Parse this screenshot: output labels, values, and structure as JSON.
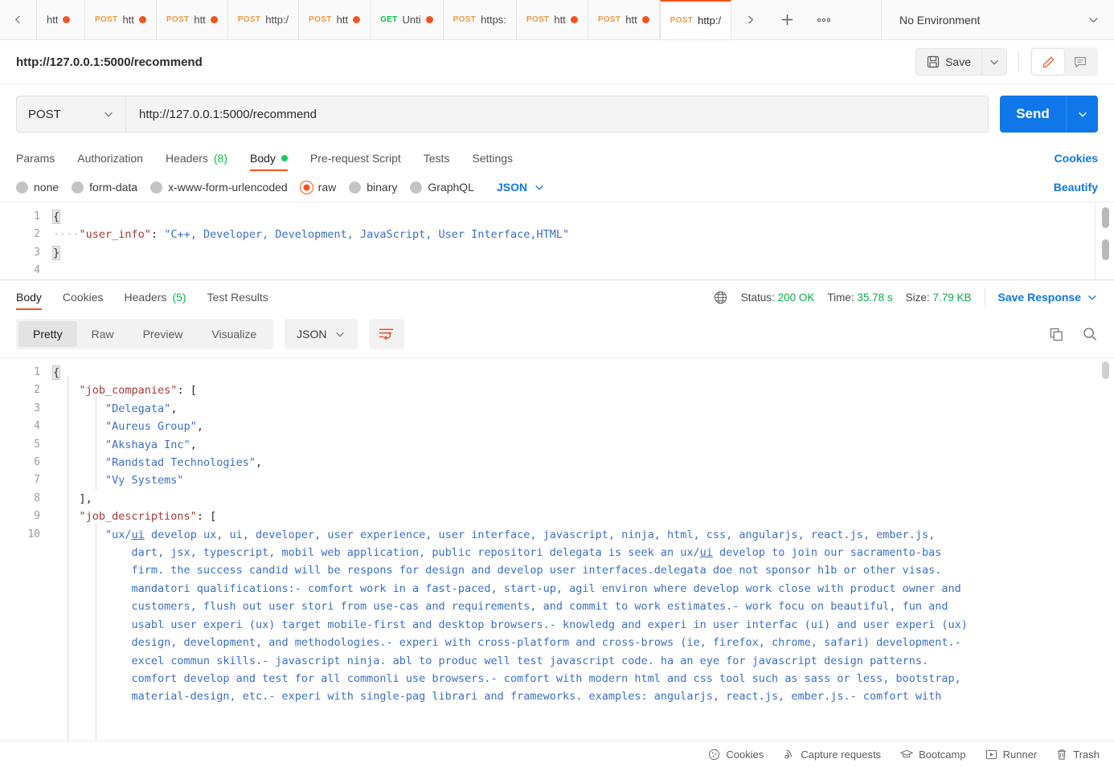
{
  "tabstrip": {
    "scroll_left_icon": "chevron-left-icon",
    "tabs": [
      {
        "method": "",
        "label": "htt",
        "unsaved": true,
        "active": false
      },
      {
        "method": "POST",
        "label": "htt",
        "unsaved": true,
        "active": false
      },
      {
        "method": "POST",
        "label": "htt",
        "unsaved": true,
        "active": false
      },
      {
        "method": "POST",
        "label": "http:/",
        "unsaved": false,
        "active": false
      },
      {
        "method": "POST",
        "label": "htt",
        "unsaved": true,
        "active": false
      },
      {
        "method": "GET",
        "label": "Unti",
        "unsaved": true,
        "active": false
      },
      {
        "method": "POST",
        "label": "https:",
        "unsaved": false,
        "active": false
      },
      {
        "method": "POST",
        "label": "htt",
        "unsaved": true,
        "active": false
      },
      {
        "method": "POST",
        "label": "htt",
        "unsaved": true,
        "active": false
      },
      {
        "method": "POST",
        "label": "http:/",
        "unsaved": false,
        "active": true
      }
    ],
    "next_icon": "chevron-right-icon",
    "new_tab_icon": "plus-icon",
    "more_icon": "ellipsis-icon",
    "environment": "No Environment",
    "environment_caret": "chevron-down-icon"
  },
  "request_header": {
    "title": "http://127.0.0.1:5000/recommend",
    "save_label": "Save",
    "save_icon": "floppy-disk-icon",
    "save_caret_icon": "chevron-down-icon",
    "edit_icon": "pencil-icon",
    "comment_icon": "comment-icon"
  },
  "url_bar": {
    "method": "POST",
    "method_caret_icon": "chevron-down-icon",
    "url": "http://127.0.0.1:5000/recommend",
    "send_label": "Send",
    "send_caret_icon": "chevron-down-icon"
  },
  "request_tabs": {
    "items": [
      {
        "label": "Params",
        "active": false
      },
      {
        "label": "Authorization",
        "active": false
      },
      {
        "label": "Headers",
        "count": "(8)",
        "active": false
      },
      {
        "label": "Body",
        "active": true,
        "dot": true
      },
      {
        "label": "Pre-request Script",
        "active": false
      },
      {
        "label": "Tests",
        "active": false
      },
      {
        "label": "Settings",
        "active": false
      }
    ],
    "cookies_label": "Cookies"
  },
  "body_types": {
    "options": [
      {
        "label": "none",
        "selected": false
      },
      {
        "label": "form-data",
        "selected": false
      },
      {
        "label": "x-www-form-urlencoded",
        "selected": false
      },
      {
        "label": "raw",
        "selected": true
      },
      {
        "label": "binary",
        "selected": false
      },
      {
        "label": "GraphQL",
        "selected": false
      }
    ],
    "format": "JSON",
    "format_caret_icon": "chevron-down-icon",
    "beautify_label": "Beautify"
  },
  "request_body": {
    "line_numbers": [
      "1",
      "2",
      "3",
      "4"
    ],
    "lines": [
      "{",
      "    \"user_info\": \"C++, Developer, Development, JavaScript, User Interface,HTML\"",
      "}",
      ""
    ],
    "key": "\"user_info\"",
    "value": "\"C++, Developer, Development, JavaScript, User Interface,HTML\""
  },
  "response": {
    "tabs": [
      {
        "label": "Body",
        "active": true
      },
      {
        "label": "Cookies",
        "active": false
      },
      {
        "label": "Headers",
        "count": "(5)",
        "active": false
      },
      {
        "label": "Test Results",
        "active": false
      }
    ],
    "globe_icon": "globe-icon",
    "status_label": "Status:",
    "status_value": "200 OK",
    "time_label": "Time:",
    "time_value": "35.78 s",
    "size_label": "Size:",
    "size_value": "7.79 KB",
    "save_response_label": "Save Response",
    "save_response_caret_icon": "chevron-down-icon",
    "view_modes": [
      {
        "label": "Pretty",
        "active": true
      },
      {
        "label": "Raw",
        "active": false
      },
      {
        "label": "Preview",
        "active": false
      },
      {
        "label": "Visualize",
        "active": false
      }
    ],
    "format": "JSON",
    "format_caret_icon": "chevron-down-icon",
    "wrap_icon": "wrap-lines-icon",
    "copy_icon": "copy-icon",
    "search_icon": "search-icon"
  },
  "response_body": {
    "line_numbers": [
      "1",
      "2",
      "3",
      "4",
      "5",
      "6",
      "7",
      "8",
      "9",
      "10"
    ],
    "job_companies_key": "\"job_companies\"",
    "job_companies": [
      "\"Delegata\",",
      "\"Aureus Group\",",
      "\"Akshaya Inc\",",
      "\"Randstad Technologies\",",
      "\"Vy Systems\""
    ],
    "job_descriptions_key": "\"job_descriptions\"",
    "description_lines": [
      "\"ux/ui develop ux, ui, developer, user experience, user interface, javascript, ninja, html, css, angularjs, react.js, ember.js,",
      "dart, jsx, typescript, mobil web application, public repositori delegata is seek an ux/ui develop to join our sacramento-bas",
      "firm. the success candid will be respons for design and develop user interfaces.delegata doe not sponsor h1b or other visas.",
      "mandatori qualifications:- comfort work in a fast-paced, start-up, agil environ where develop work close with product owner and",
      "customers, flush out user stori from use-cas and requirements, and commit to work estimates.- work focu on beautiful, fun and",
      "usabl user experi (ux) target mobile-first and desktop browsers.- knowledg and experi in user interfac (ui) and user experi (ux)",
      "design, development, and methodologies.- experi with cross-platform and cross-brows (ie, firefox, chrome, safari) development.-",
      "excel commun skills.- javascript ninja. abl to produc well test javascript code. ha an eye for javascript design patterns.",
      "comfort develop and test for all commonli use browsers.- comfort with modern html and css tool such as sass or less, bootstrap,",
      "material-design, etc.- experi with single-pag librari and frameworks. examples: angularjs, react.js, ember.js.- comfort with"
    ]
  },
  "statusbar": {
    "items": [
      {
        "label": "Cookies",
        "icon": "cookie-icon"
      },
      {
        "label": "Capture requests",
        "icon": "satellite-icon"
      },
      {
        "label": "Bootcamp",
        "icon": "graduation-cap-icon"
      },
      {
        "label": "Runner",
        "icon": "play-box-icon"
      },
      {
        "label": "Trash",
        "icon": "trash-icon"
      }
    ]
  },
  "colors": {
    "accent_orange": "#f3541e",
    "accent_blue": "#0f77e8",
    "status_green": "#0cab4a",
    "method_post": "#ed9a46",
    "method_get": "#0cbb52"
  }
}
